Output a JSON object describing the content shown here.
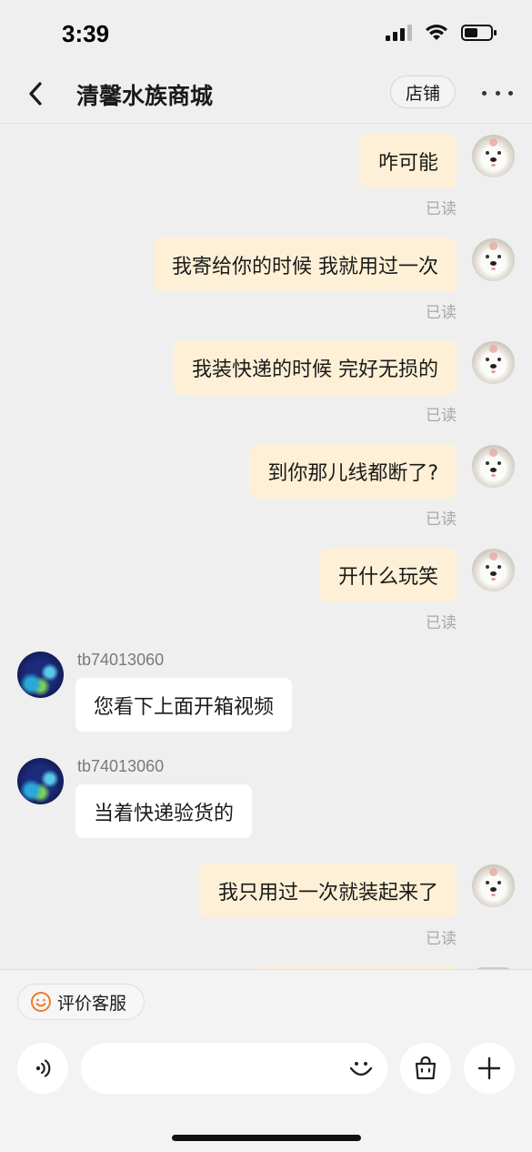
{
  "status_bar": {
    "time": "3:39"
  },
  "header": {
    "title": "清馨水族商城",
    "store_label": "店铺"
  },
  "messages": [
    {
      "side": "out",
      "text": "咋可能",
      "read": "已读"
    },
    {
      "side": "out",
      "text": "我寄给你的时候  我就用过一次",
      "read": "已读"
    },
    {
      "side": "out",
      "text": "我装快递的时候 完好无损的",
      "read": "已读"
    },
    {
      "side": "out",
      "text": "到你那儿线都断了?",
      "read": "已读"
    },
    {
      "side": "out",
      "text": "开什么玩笑",
      "read": "已读"
    },
    {
      "side": "in",
      "sender": "tb74013060",
      "text": "您看下上面开箱视频"
    },
    {
      "side": "in",
      "sender": "tb74013060",
      "text": "当着快递验货的"
    },
    {
      "side": "out",
      "text": "我只用过一次就装起来了",
      "read": "已读"
    }
  ],
  "bottom": {
    "rate_label": "评价客服",
    "input_placeholder": ""
  },
  "icons": {
    "back": "chevron-left-icon",
    "more": "more-dots-icon",
    "voice": "voice-icon",
    "emoji": "emoji-icon",
    "bag": "shopping-bag-icon",
    "add": "plus-icon",
    "rate": "smile-icon"
  },
  "colors": {
    "outgoing_bubble": "#fdf0d6",
    "incoming_bubble": "#ffffff",
    "accent_orange": "#f07a2a"
  }
}
